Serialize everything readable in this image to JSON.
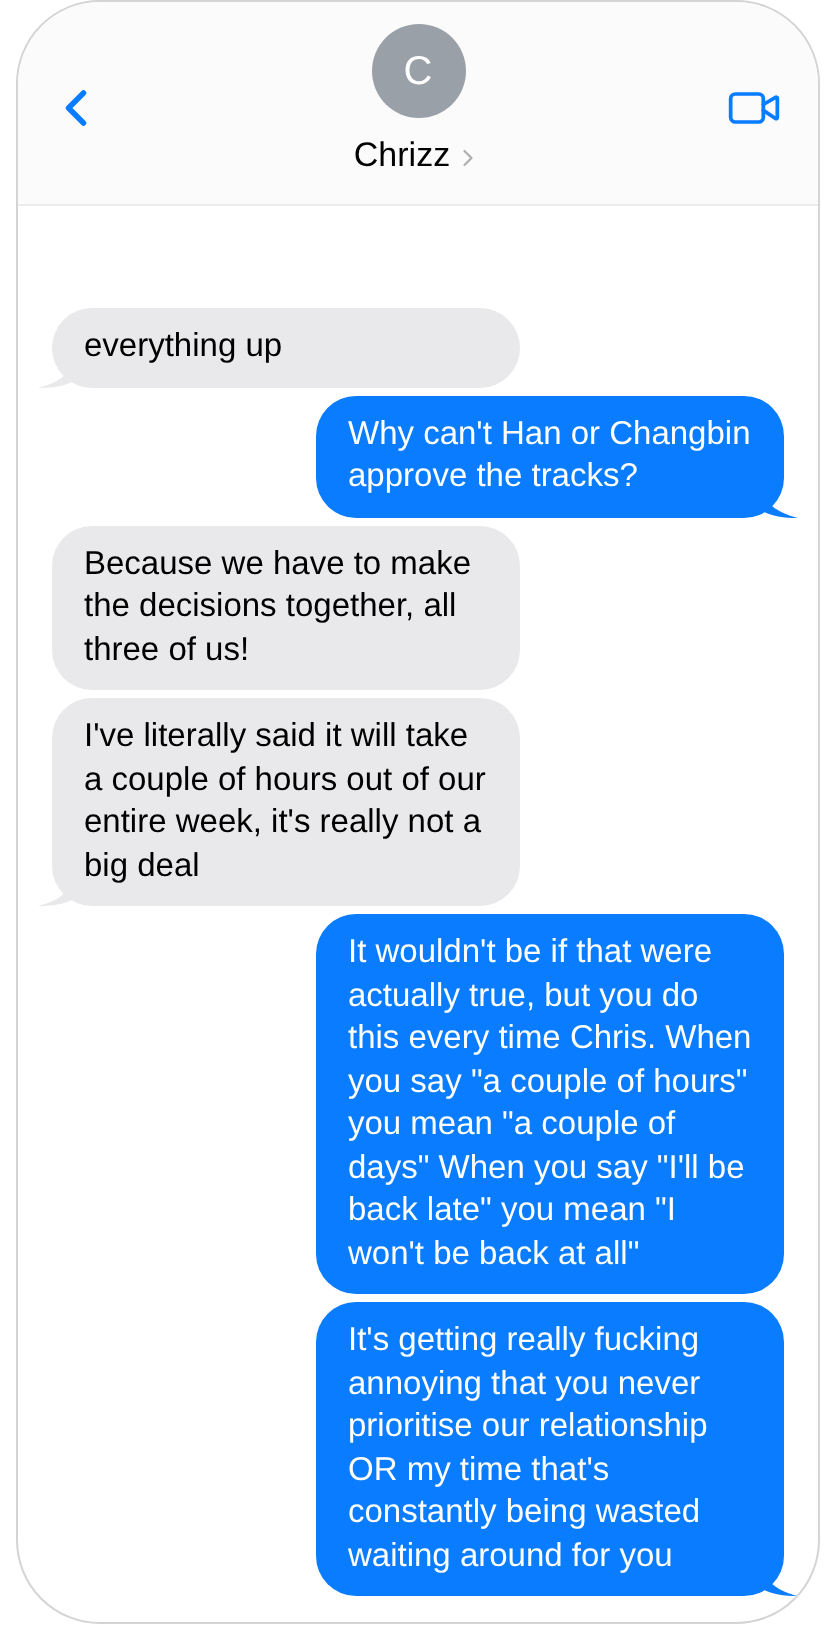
{
  "header": {
    "avatar_initial": "C",
    "contact_name": "Chrizz"
  },
  "messages": [
    {
      "kind": "incoming",
      "tail": true,
      "text": "everything up"
    },
    {
      "kind": "outgoing",
      "tail": true,
      "text": "Why can't Han or Changbin approve the tracks?"
    },
    {
      "kind": "incoming",
      "tail": false,
      "text": "Because we have to make the decisions together, all three of us!"
    },
    {
      "kind": "incoming",
      "tail": true,
      "text": "I've literally said it will take a couple of hours out of our entire week, it's really not a big deal"
    },
    {
      "kind": "outgoing",
      "tail": false,
      "text": "It wouldn't be if that were actually true, but you do this every time Chris. When you say \"a couple of hours\" you mean \"a couple of days\" When you say \"I'll be back late\" you mean \"I won't be back at all\""
    },
    {
      "kind": "outgoing",
      "tail": true,
      "text": "It's getting really fucking annoying that you never prioritise our relationship OR my time that's constantly being wasted waiting around for you"
    }
  ]
}
